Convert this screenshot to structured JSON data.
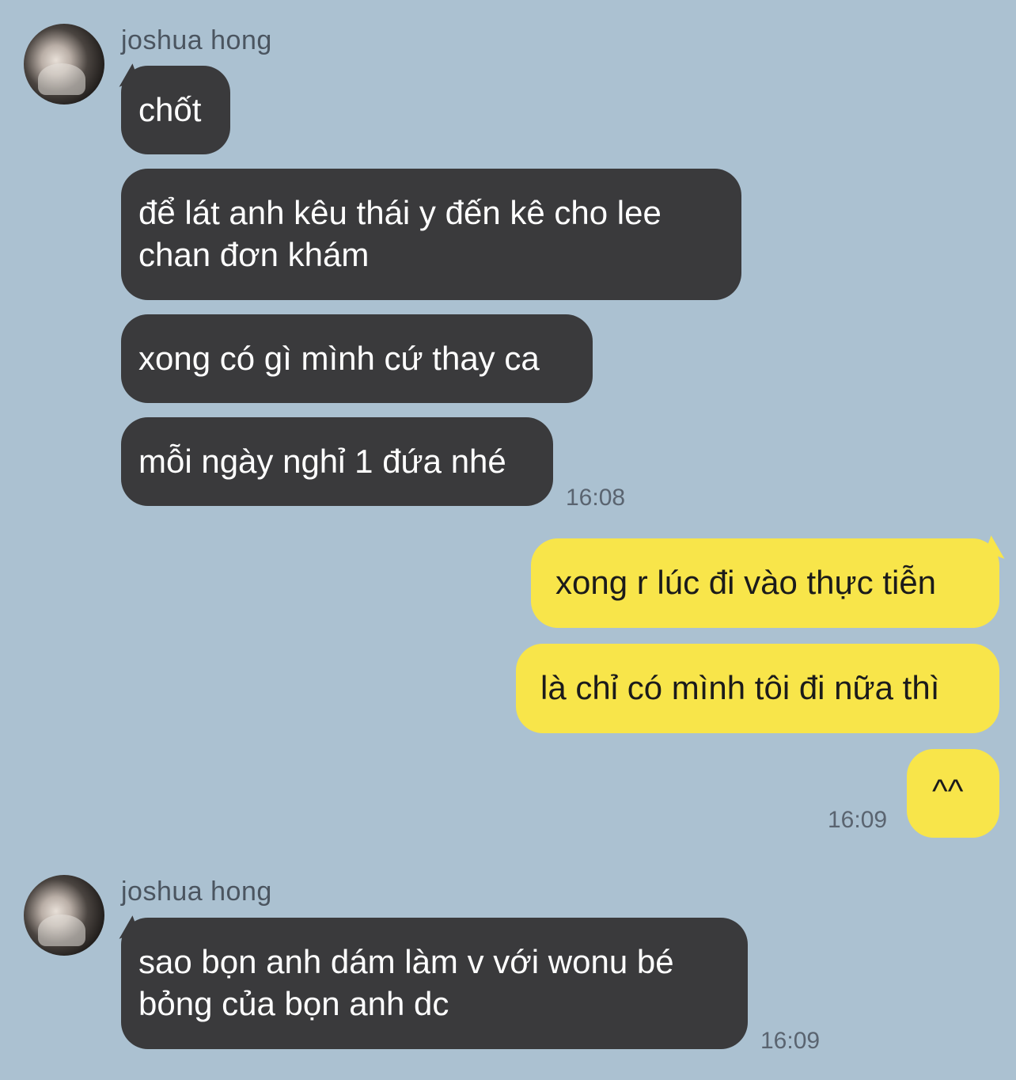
{
  "chat": {
    "group1": {
      "sender": "joshua hong",
      "messages": [
        {
          "lines": [
            "chốt"
          ]
        },
        {
          "lines": [
            "để lát anh kêu thái y đến kê cho lee",
            "chan đơn khám"
          ]
        },
        {
          "lines": [
            "xong có gì mình cứ thay ca"
          ]
        },
        {
          "lines": [
            "mỗi ngày nghỉ 1 đứa nhé"
          ]
        }
      ],
      "time": "16:08"
    },
    "group2": {
      "messages": [
        {
          "lines": [
            "xong r lúc đi vào thực tiễn"
          ]
        },
        {
          "lines": [
            "là chỉ có mình tôi đi nữa thì"
          ]
        },
        {
          "lines": [
            "^^"
          ]
        }
      ],
      "time": "16:09"
    },
    "group3": {
      "sender": "joshua hong",
      "messages": [
        {
          "lines": [
            "sao bọn anh dám làm v với wonu bé",
            "bỏng của bọn anh dc"
          ]
        }
      ],
      "time": "16:09"
    }
  },
  "icons": {
    "avatar": "profile-photo"
  },
  "colors": {
    "background": "#abc1d1",
    "incoming_bubble": "#3a3a3c",
    "outgoing_bubble": "#f8e54a"
  }
}
